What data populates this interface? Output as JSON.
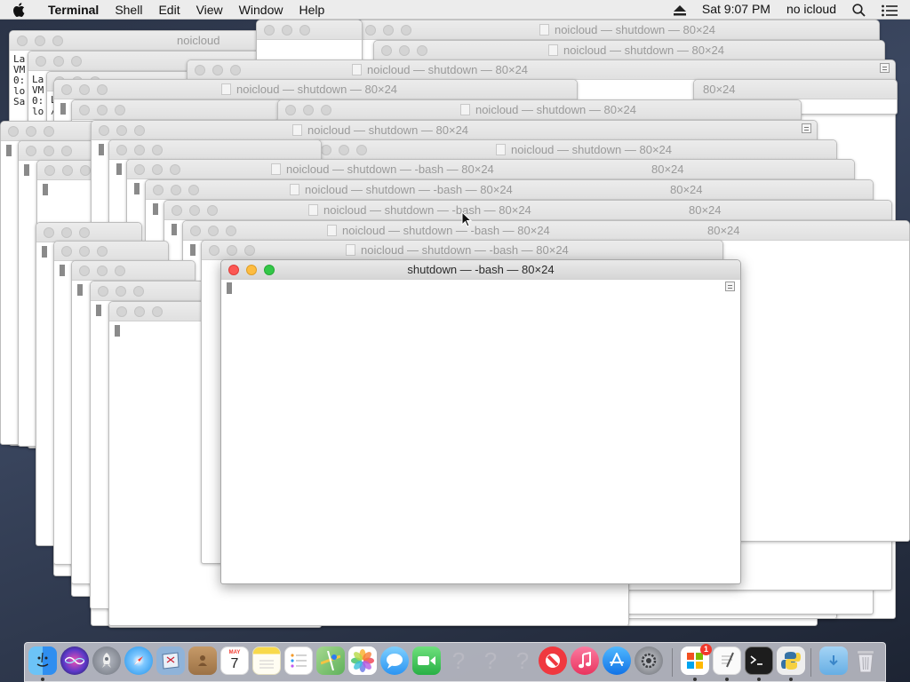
{
  "menubar": {
    "app_name": "Terminal",
    "items": [
      "Shell",
      "Edit",
      "View",
      "Window",
      "Help"
    ],
    "clock": "Sat 9:07 PM",
    "user": "no icloud"
  },
  "titles": {
    "plain": "noicloud — shutdown — 80×24",
    "bash": "noicloud — shutdown — -bash — 80×24",
    "short": "noicloud",
    "size": "80×24",
    "active": "shutdown — -bash — 80×24"
  },
  "terminal_fragments": {
    "left_col_a": [
      "La",
      "VM",
      "0:",
      "lo",
      "Sa"
    ],
    "left_col_b": [
      "La",
      "VM",
      "0:",
      "lo"
    ],
    "left_col_c": [
      "L",
      "/"
    ]
  },
  "dock": {
    "items": [
      {
        "name": "finder",
        "icon": "finder-icon",
        "color": "#2f8ef0"
      },
      {
        "name": "siri",
        "icon": "siri-icon",
        "color": "#5b39c9"
      },
      {
        "name": "launchpad",
        "icon": "rocket-icon",
        "color": "#8a8f99"
      },
      {
        "name": "safari",
        "icon": "compass-icon",
        "color": "#1e90e8"
      },
      {
        "name": "mail",
        "icon": "mail-stamp-icon",
        "color": "#6d8fb8"
      },
      {
        "name": "contacts",
        "icon": "contacts-book-icon",
        "color": "#b38b5d"
      },
      {
        "name": "calendar",
        "icon": "calendar-icon",
        "color": "#ffffff"
      },
      {
        "name": "notes",
        "icon": "notes-icon",
        "color": "#f7dc55"
      },
      {
        "name": "reminders",
        "icon": "list-icon",
        "color": "#fdfdfd"
      },
      {
        "name": "maps",
        "icon": "map-icon",
        "color": "#77c071"
      },
      {
        "name": "photos",
        "icon": "photos-icon",
        "color": "#fefefe"
      },
      {
        "name": "messages",
        "icon": "chat-bubble-icon",
        "color": "#4fb3f7"
      },
      {
        "name": "facetime",
        "icon": "video-camera-icon",
        "color": "#3dc65b"
      },
      {
        "name": "unknown1",
        "icon": "question-mark-icon",
        "color": "transparent"
      },
      {
        "name": "unknown2",
        "icon": "question-mark-icon",
        "color": "transparent"
      },
      {
        "name": "unknown3",
        "icon": "question-mark-icon",
        "color": "transparent"
      },
      {
        "name": "news",
        "icon": "news-icon",
        "color": "#f0383f"
      },
      {
        "name": "music",
        "icon": "music-note-icon",
        "color": "#f2476a"
      },
      {
        "name": "app-store",
        "icon": "app-store-icon",
        "color": "#1b8ef5"
      },
      {
        "name": "system-preferences",
        "icon": "gear-icon",
        "color": "#7d7f85"
      },
      {
        "name": "microsoft-office",
        "icon": "office-icon",
        "color": "#f8f8f8",
        "badge": "1"
      },
      {
        "name": "textedit",
        "icon": "pen-paper-icon",
        "color": "#f4f4f4"
      },
      {
        "name": "terminal",
        "icon": "terminal-icon",
        "color": "#1d1d1d"
      },
      {
        "name": "python",
        "icon": "python-icon",
        "color": "#e9e9e9"
      },
      {
        "name": "downloads",
        "icon": "download-folder-icon",
        "color": "#6fb2e6"
      },
      {
        "name": "trash",
        "icon": "trash-icon",
        "color": "#d9d9d9"
      }
    ],
    "calendar_month": "MAY",
    "calendar_day": "7"
  }
}
